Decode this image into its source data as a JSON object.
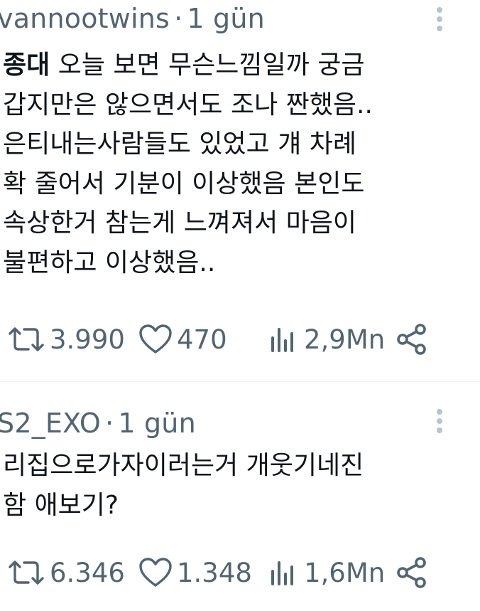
{
  "tweets": [
    {
      "handle": "vannootwins",
      "separator": "·",
      "time": "1 gün",
      "lines": [
        {
          "bold": "종대",
          "text": " 오늘 보면 무슨느낌일까 궁금"
        },
        {
          "bold": "",
          "text": "갑지만은 않으면서도 조나 짠했음.."
        },
        {
          "bold": "",
          "text": "은티내는사람들도 있었고 걔 차례"
        },
        {
          "bold": "",
          "text": " 확 줄어서 기분이 이상했음 본인도"
        },
        {
          "bold": "",
          "text": "속상한거 참는게 느껴져서 마음이"
        },
        {
          "bold": "",
          "text": "불편하고 이상했음.."
        }
      ],
      "retweets": "3.990",
      "likes": "470",
      "views": "2,9Mn"
    },
    {
      "handle": "S2_EXO",
      "separator": "·",
      "time": "1 gün",
      "lines": [
        {
          "bold": "",
          "text": "리집으로가자이러는거 개웃기네진"
        },
        {
          "bold": "",
          "text": "함 애보기?"
        }
      ],
      "retweets": "6.346",
      "likes": "1.348",
      "views": "1,6Mn"
    }
  ],
  "icons": {
    "retweet": "retweet-icon",
    "like": "heart-icon",
    "views": "bar-chart-icon",
    "share": "share-icon",
    "more": "more-options-icon"
  },
  "colors": {
    "text": "#0f1419",
    "secondary": "#536471",
    "divider": "#eff3f4",
    "dots": "#b9c3cb"
  }
}
